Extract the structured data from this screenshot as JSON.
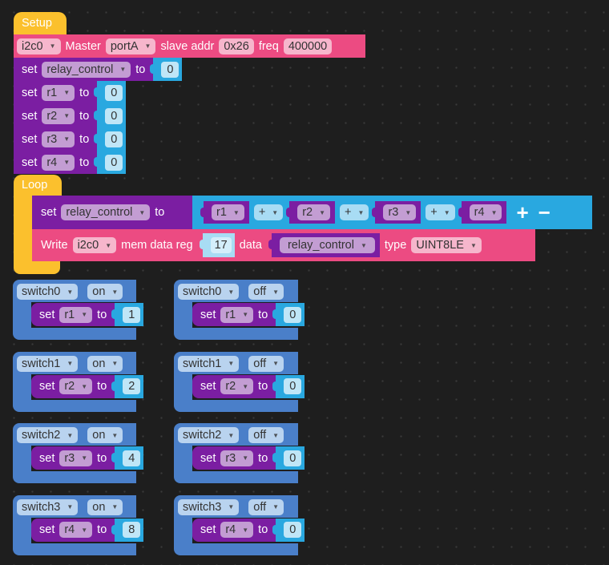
{
  "workspace": {
    "name": "block-editor-canvas"
  },
  "setup": {
    "title": "Setup",
    "i2c": {
      "port_var": "i2c0",
      "mode_label": "Master",
      "port": "portA",
      "addr_label": "slave addr",
      "addr": "0x26",
      "freq_label": "freq",
      "freq": "400000"
    },
    "init_rows": [
      {
        "set": "set",
        "var": "relay_control",
        "to": "to",
        "value": "0"
      },
      {
        "set": "set",
        "var": "r1",
        "to": "to",
        "value": "0"
      },
      {
        "set": "set",
        "var": "r2",
        "to": "to",
        "value": "0"
      },
      {
        "set": "set",
        "var": "r3",
        "to": "to",
        "value": "0"
      },
      {
        "set": "set",
        "var": "r4",
        "to": "to",
        "value": "0"
      }
    ]
  },
  "loop": {
    "title": "Loop",
    "assign": {
      "set": "set",
      "var": "relay_control",
      "to": "to",
      "terms": [
        "r1",
        "r2",
        "r3",
        "r4"
      ],
      "op": "+",
      "plus": "+",
      "minus": "−"
    },
    "write": {
      "label": "Write",
      "port_var": "i2c0",
      "reg_label": "mem data reg",
      "reg": "17",
      "data_label": "data",
      "data_var": "relay_control",
      "type_label": "type",
      "type": "UINT8LE"
    }
  },
  "switch_handlers": [
    {
      "switch": "switch0",
      "state": "on",
      "set": "set",
      "var": "r1",
      "to": "to",
      "value": "1"
    },
    {
      "switch": "switch0",
      "state": "off",
      "set": "set",
      "var": "r1",
      "to": "to",
      "value": "0"
    },
    {
      "switch": "switch1",
      "state": "on",
      "set": "set",
      "var": "r2",
      "to": "to",
      "value": "2"
    },
    {
      "switch": "switch1",
      "state": "off",
      "set": "set",
      "var": "r2",
      "to": "to",
      "value": "0"
    },
    {
      "switch": "switch2",
      "state": "on",
      "set": "set",
      "var": "r3",
      "to": "to",
      "value": "4"
    },
    {
      "switch": "switch2",
      "state": "off",
      "set": "set",
      "var": "r3",
      "to": "to",
      "value": "0"
    },
    {
      "switch": "switch3",
      "state": "on",
      "set": "set",
      "var": "r4",
      "to": "to",
      "value": "8"
    },
    {
      "switch": "switch3",
      "state": "off",
      "set": "set",
      "var": "r4",
      "to": "to",
      "value": "0"
    }
  ],
  "colors": {
    "background": "#1e1e1e",
    "setup_hat": "#fbc02d",
    "i2c_block": "#ec4b82",
    "variable_block": "#7b1ea2",
    "math_block": "#29a8e0",
    "event_block": "#4a7fc9"
  }
}
